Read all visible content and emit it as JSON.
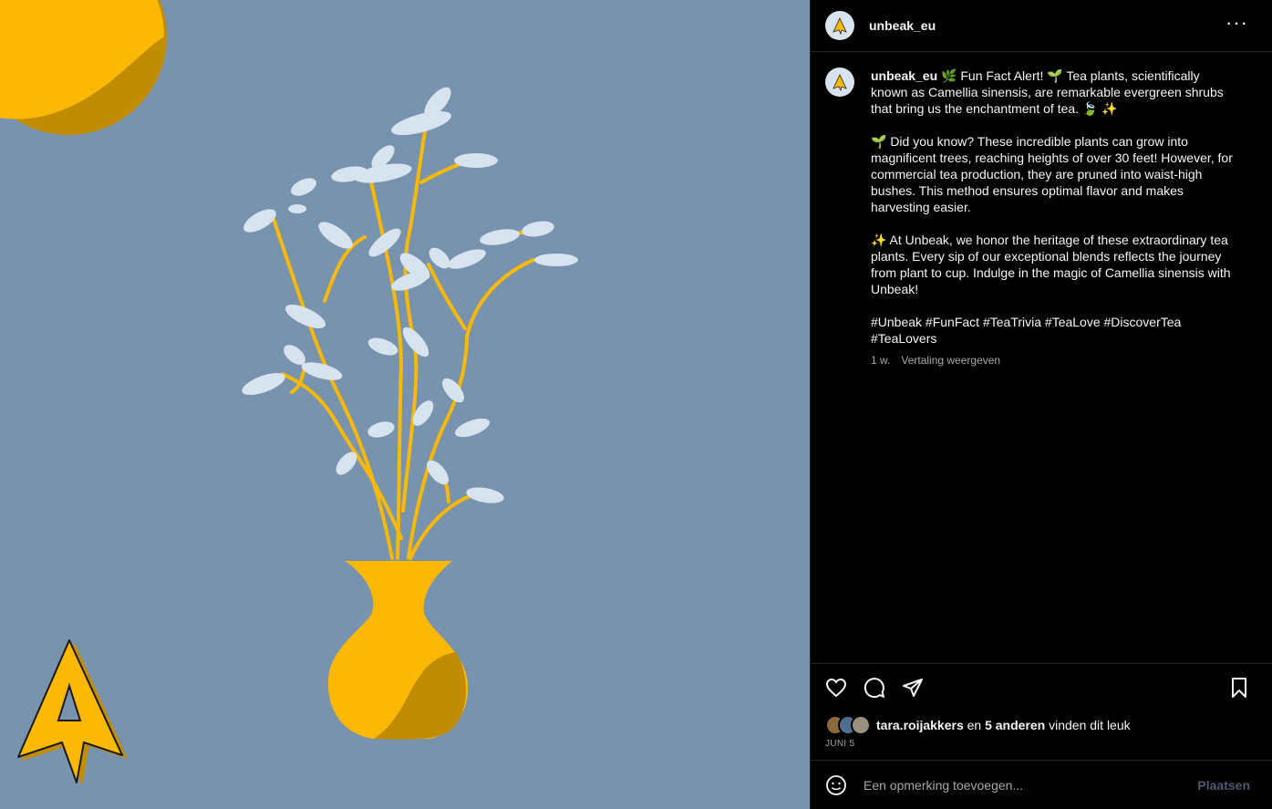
{
  "post": {
    "username": "unbeak_eu",
    "more_icon": "ellipsis-icon"
  },
  "caption": {
    "username": "unbeak_eu",
    "p1": "🌿 Fun Fact Alert! 🌱 Tea plants, scientifically known as Camellia sinensis, are remarkable evergreen shrubs that bring us the enchantment of tea. 🍃 ✨",
    "p2": "🌱 Did you know? These incredible plants can grow into magnificent trees, reaching heights of over 30 feet! However, for commercial tea production, they are pruned into waist-high bushes. This method ensures optimal flavor and makes harvesting easier.",
    "p3": "✨ At Unbeak, we honor the heritage of these extraordinary tea plants. Every sip of our exceptional blends reflects the journey from plant to cup. Indulge in the magic of Camellia sinensis with Unbeak!",
    "hashtags": "#Unbeak #FunFact #TeaTrivia #TeaLove #DiscoverTea #TeaLovers",
    "time": "1 w.",
    "translate": "Vertaling weergeven"
  },
  "likes": {
    "user": "tara.roijakkers",
    "en": "en",
    "others": "5 anderen",
    "suffix": "vinden dit leuk",
    "date": "JUNI 5"
  },
  "comment": {
    "placeholder": "Een opmerking toevoegen...",
    "post_label": "Plaatsen"
  },
  "colors": {
    "image_bg": "#7893ad",
    "yellow": "#fbb805",
    "dark_yellow": "#c28c00",
    "leaf": "#d7e3ee"
  }
}
